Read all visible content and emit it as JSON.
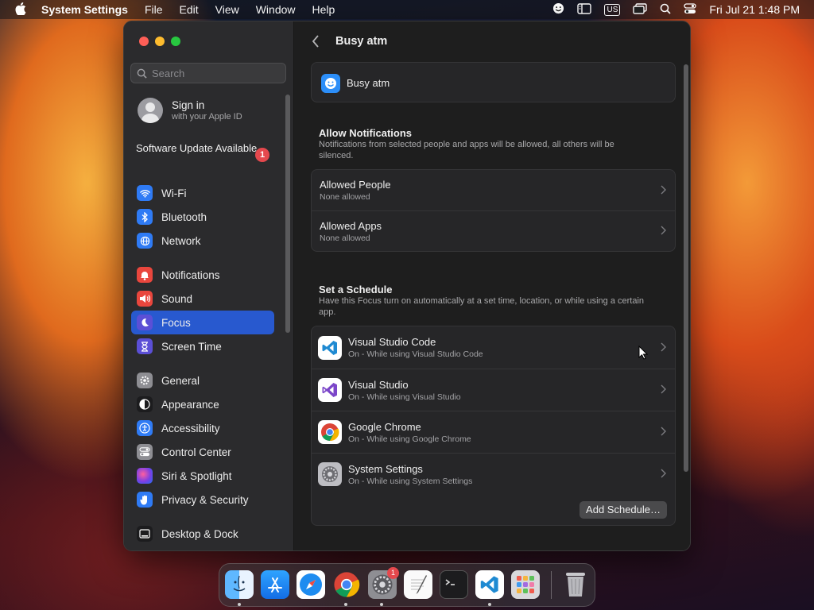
{
  "menubar": {
    "app_name": "System Settings",
    "menus": [
      "File",
      "Edit",
      "View",
      "Window",
      "Help"
    ],
    "keyboard_layout": "US",
    "datetime": "Fri Jul 21  1:48 PM"
  },
  "sidebar": {
    "search_placeholder": "Search",
    "account": {
      "title": "Sign in",
      "subtitle": "with your Apple ID"
    },
    "update": {
      "label": "Software Update Available",
      "badge": "1"
    },
    "items": [
      {
        "label": "Wi-Fi",
        "icon": "wifi-icon",
        "color": "#2f7bf5"
      },
      {
        "label": "Bluetooth",
        "icon": "bluetooth-icon",
        "color": "#2f7bf5"
      },
      {
        "label": "Network",
        "icon": "network-icon",
        "color": "#2f7bf5"
      },
      {
        "label": "Notifications",
        "icon": "notifications-icon",
        "color": "#e9463d"
      },
      {
        "label": "Sound",
        "icon": "sound-icon",
        "color": "#e9463d"
      },
      {
        "label": "Focus",
        "icon": "focus-moon-icon",
        "color": "#5b4fd6",
        "selected": true
      },
      {
        "label": "Screen Time",
        "icon": "screen-time-icon",
        "color": "#5b4fd6"
      },
      {
        "label": "General",
        "icon": "general-gear-icon",
        "color": "#8e8e93"
      },
      {
        "label": "Appearance",
        "icon": "appearance-icon",
        "color": "#1c1c1e"
      },
      {
        "label": "Accessibility",
        "icon": "accessibility-icon",
        "color": "#2f7bf5"
      },
      {
        "label": "Control Center",
        "icon": "control-center-icon",
        "color": "#8e8e93"
      },
      {
        "label": "Siri & Spotlight",
        "icon": "siri-icon",
        "color": "#b03fd1"
      },
      {
        "label": "Privacy & Security",
        "icon": "privacy-hand-icon",
        "color": "#2f7bf5"
      },
      {
        "label": "Desktop & Dock",
        "icon": "desktop-dock-icon",
        "color": "#1c1c1e"
      }
    ]
  },
  "main": {
    "title": "Busy atm",
    "focus_name": "Busy atm",
    "allow": {
      "title": "Allow Notifications",
      "description": "Notifications from selected people and apps will be allowed, all others will be silenced.",
      "rows": [
        {
          "title": "Allowed People",
          "subtitle": "None allowed"
        },
        {
          "title": "Allowed Apps",
          "subtitle": "None allowed"
        }
      ]
    },
    "schedule": {
      "title": "Set a Schedule",
      "description": "Have this Focus turn on automatically at a set time, location, or while using a certain app.",
      "rows": [
        {
          "title": "Visual Studio Code",
          "subtitle": "On - While using Visual Studio Code",
          "icon": "vscode-icon"
        },
        {
          "title": "Visual Studio",
          "subtitle": "On - While using Visual Studio",
          "icon": "visual-studio-icon"
        },
        {
          "title": "Google Chrome",
          "subtitle": "On - While using Google Chrome",
          "icon": "chrome-icon"
        },
        {
          "title": "System Settings",
          "subtitle": "On - While using System Settings",
          "icon": "system-settings-icon"
        }
      ],
      "add_button": "Add Schedule…"
    }
  },
  "dock": {
    "apps": [
      "finder-icon",
      "app-store-icon",
      "safari-icon",
      "chrome-icon",
      "system-settings-icon",
      "textedit-icon",
      "terminal-icon",
      "vscode-icon",
      "launchpad-icon",
      "trash-icon"
    ],
    "settings_badge": "1"
  }
}
